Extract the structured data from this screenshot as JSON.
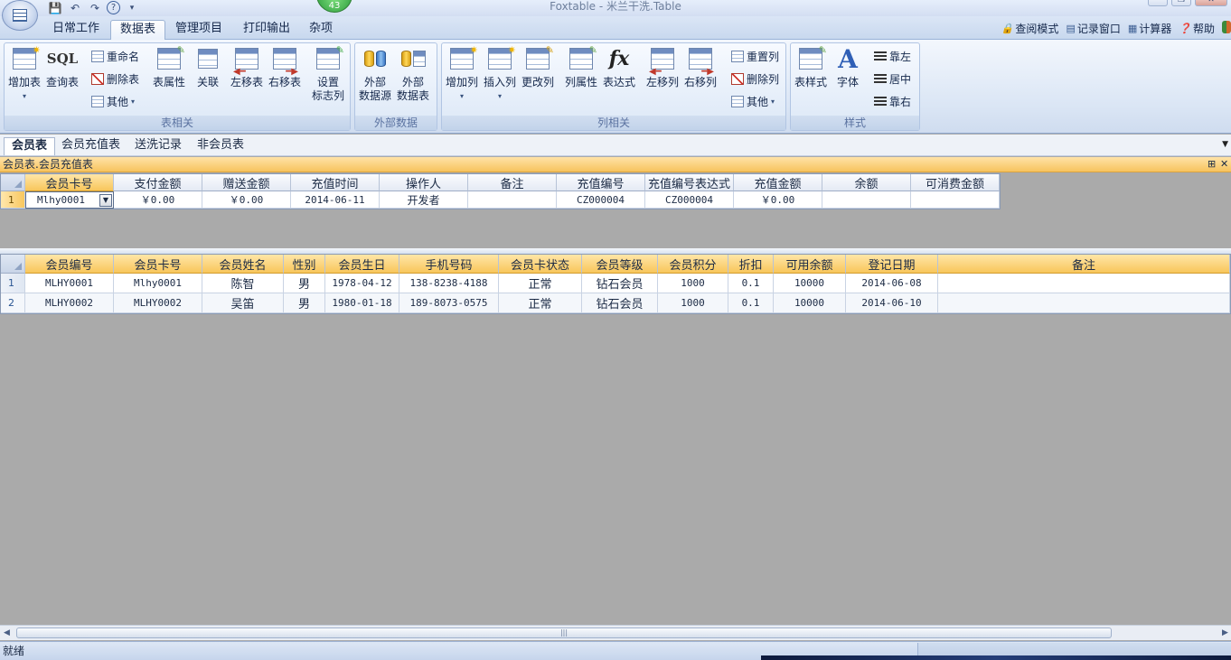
{
  "window": {
    "title": "Foxtable - 米兰干洗.Table",
    "badge": "43",
    "controls": [
      "─",
      "❐",
      "✕"
    ]
  },
  "quick_access": {
    "save": "💾",
    "undo": "↶",
    "redo": "↷",
    "help": "?",
    "more": "▾"
  },
  "ribbon_tabs": [
    "日常工作",
    "数据表",
    "管理项目",
    "打印输出",
    "杂项"
  ],
  "right_tools": [
    {
      "icon": "lock-icon",
      "glyph": "🔒",
      "label": "查阅模式"
    },
    {
      "icon": "window-icon",
      "glyph": "▤",
      "label": "记录窗口"
    },
    {
      "icon": "calculator-icon",
      "glyph": "▦",
      "label": "计算器"
    },
    {
      "icon": "help-icon",
      "glyph": "❓",
      "label": "帮助"
    }
  ],
  "ribbon": {
    "groups": {
      "table": "表相关",
      "external": "外部数据",
      "column": "列相关",
      "style": "样式"
    },
    "table_buttons": {
      "add_table": "增加表",
      "query_table": "查询表",
      "sql": "SQL",
      "rename": "重命名",
      "delete_table": "删除表",
      "other": "其他",
      "table_props": "表属性",
      "relation": "关联",
      "move_left": "左移表",
      "move_right": "右移表",
      "set_flag_col_1": "设置",
      "set_flag_col_2": "标志列"
    },
    "external_buttons": {
      "ext_source_1": "外部",
      "ext_source_2": "数据源",
      "ext_table_1": "外部",
      "ext_table_2": "数据表"
    },
    "column_buttons": {
      "add_col": "增加列",
      "insert_col": "插入列",
      "change_col": "更改列",
      "col_props": "列属性",
      "expression": "表达式",
      "fx": "fx",
      "move_col_left": "左移列",
      "move_col_right": "右移列",
      "reset_col": "重置列",
      "delete_col": "删除列",
      "other": "其他"
    },
    "style_buttons": {
      "table_style": "表样式",
      "font": "字体",
      "font_glyph": "A",
      "align_left": "靠左",
      "align_center": "居中",
      "align_right": "靠右"
    }
  },
  "doc_tabs": [
    "会员表",
    "会员充值表",
    "送洗记录",
    "非会员表"
  ],
  "panel": {
    "title": "会员表.会员充值表",
    "pin": "⊞",
    "close": "✕"
  },
  "recharge_table": {
    "headers": [
      "会员卡号",
      "支付金额",
      "赠送金额",
      "充值时间",
      "操作人",
      "备注",
      "充值编号",
      "充值编号表达式",
      "充值金额",
      "余额",
      "可消费金额"
    ],
    "rows": [
      {
        "num": "1",
        "cells": [
          "Mlhy0001",
          "￥0.00",
          "￥0.00",
          "2014-06-11",
          "开发者",
          "",
          "CZ000004",
          "CZ000004",
          "￥0.00",
          "",
          ""
        ]
      }
    ]
  },
  "member_table": {
    "headers": [
      "会员编号",
      "会员卡号",
      "会员姓名",
      "性别",
      "会员生日",
      "手机号码",
      "会员卡状态",
      "会员等级",
      "会员积分",
      "折扣",
      "可用余额",
      "登记日期",
      "备注"
    ],
    "rows": [
      {
        "num": "1",
        "cells": [
          "MLHY0001",
          "Mlhy0001",
          "陈智",
          "男",
          "1978-04-12",
          "138-8238-4188",
          "正常",
          "钻石会员",
          "1000",
          "0.1",
          "10000",
          "2014-06-08",
          ""
        ]
      },
      {
        "num": "2",
        "cells": [
          "MLHY0002",
          "MLHY0002",
          "吴笛",
          "男",
          "1980-01-18",
          "189-8073-0575",
          "正常",
          "钻石会员",
          "1000",
          "0.1",
          "10000",
          "2014-06-10",
          ""
        ]
      }
    ]
  },
  "scrollbar": {
    "left": "◀",
    "right": "▶",
    "grip": "|||"
  },
  "status": {
    "text": "就绪"
  }
}
